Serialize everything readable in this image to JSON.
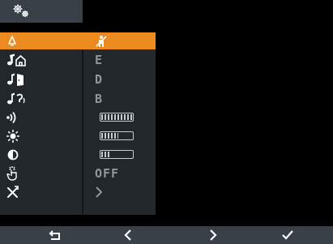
{
  "title": {
    "icon": "settings-gears-icon"
  },
  "menu": {
    "rows": [
      {
        "icon": "bell-icon",
        "value": "",
        "value_icon": "crossed-out-person-icon",
        "selected": true
      },
      {
        "icon": "melody-home-icon",
        "value": "E"
      },
      {
        "icon": "melody-door-icon",
        "value": "D"
      },
      {
        "icon": "melody-intercom-icon",
        "value": "B"
      },
      {
        "icon": "volume-icon",
        "value": "",
        "level": 1.0
      },
      {
        "icon": "brightness-icon",
        "value": "",
        "level": 0.55
      },
      {
        "icon": "contrast-icon",
        "value": "",
        "level": 0.3
      },
      {
        "icon": "touch-hand-icon",
        "value": "OFF"
      },
      {
        "icon": "tools-icon",
        "value": "",
        "value_icon": "chevron-right-icon"
      }
    ]
  },
  "navigation": {
    "buttons": [
      {
        "icon": "return-arrow-icon"
      },
      {
        "icon": "chevron-left-icon"
      },
      {
        "icon": "chevron-right-icon"
      },
      {
        "icon": "checkmark-icon"
      }
    ]
  },
  "colors": {
    "selected": "#ea8a1f",
    "panel": "#22272c",
    "bar": "#3a4047",
    "text": "#d8dde2"
  }
}
